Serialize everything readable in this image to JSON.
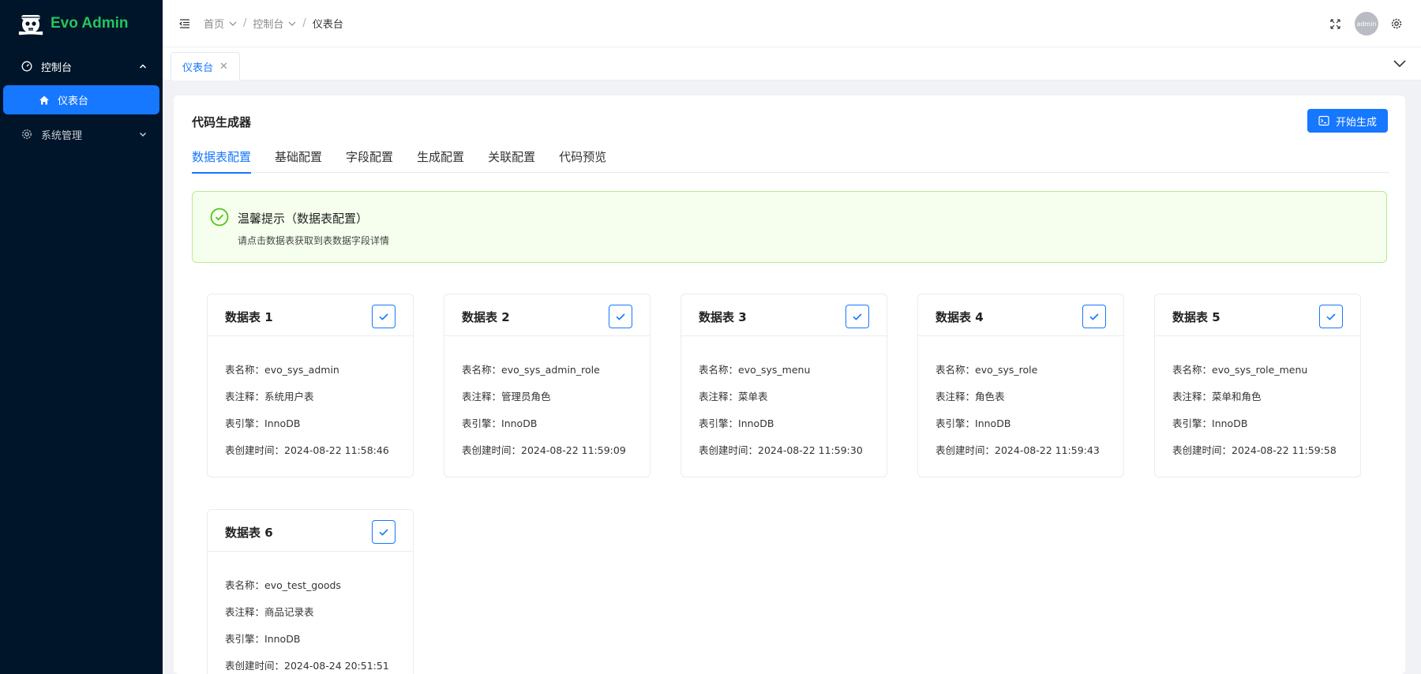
{
  "app": {
    "title": "Evo Admin"
  },
  "sidebar": {
    "groups": [
      {
        "label": "控制台",
        "icon": "dashboard-icon",
        "expanded": true,
        "children": [
          {
            "label": "仪表台",
            "icon": "home-icon",
            "active": true
          }
        ]
      },
      {
        "label": "系统管理",
        "icon": "gear-icon",
        "expanded": false
      }
    ]
  },
  "header": {
    "breadcrumbs": [
      "首页",
      "控制台",
      "仪表台"
    ],
    "separator": "/",
    "avatar_text": "admin"
  },
  "page_tabs": [
    {
      "label": "仪表台",
      "close": "✕"
    }
  ],
  "main": {
    "title": "代码生成器",
    "generate_button": "开始生成",
    "tabs": [
      "数据表配置",
      "基础配置",
      "字段配置",
      "生成配置",
      "关联配置",
      "代码预览"
    ],
    "active_tab": 0,
    "alert": {
      "title": "温馨提示（数据表配置）",
      "description": "请点击数据表获取到表数据字段详情"
    },
    "field_labels": {
      "name": "表名称：",
      "comment": "表注释：",
      "engine": "表引擎：",
      "created": "表创建时间："
    },
    "tables": [
      {
        "title": "数据表 1",
        "name": "evo_sys_admin",
        "comment": "系统用户表",
        "engine": "InnoDB",
        "created": "2024-08-22 11:58:46",
        "checked": true
      },
      {
        "title": "数据表 2",
        "name": "evo_sys_admin_role",
        "comment": "管理员角色",
        "engine": "InnoDB",
        "created": "2024-08-22 11:59:09",
        "checked": true
      },
      {
        "title": "数据表 3",
        "name": "evo_sys_menu",
        "comment": "菜单表",
        "engine": "InnoDB",
        "created": "2024-08-22 11:59:30",
        "checked": true
      },
      {
        "title": "数据表 4",
        "name": "evo_sys_role",
        "comment": "角色表",
        "engine": "InnoDB",
        "created": "2024-08-22 11:59:43",
        "checked": true
      },
      {
        "title": "数据表 5",
        "name": "evo_sys_role_menu",
        "comment": "菜单和角色",
        "engine": "InnoDB",
        "created": "2024-08-22 11:59:58",
        "checked": true
      },
      {
        "title": "数据表 6",
        "name": "evo_test_goods",
        "comment": "商品记录表",
        "engine": "InnoDB",
        "created": "2024-08-24 20:51:51",
        "checked": true
      }
    ]
  },
  "colors": {
    "sidebar_bg": "#001529",
    "accent": "#1677ff",
    "brand": "#22c55e",
    "alert_bg": "#f6ffed",
    "alert_border": "#b7eb8f"
  }
}
